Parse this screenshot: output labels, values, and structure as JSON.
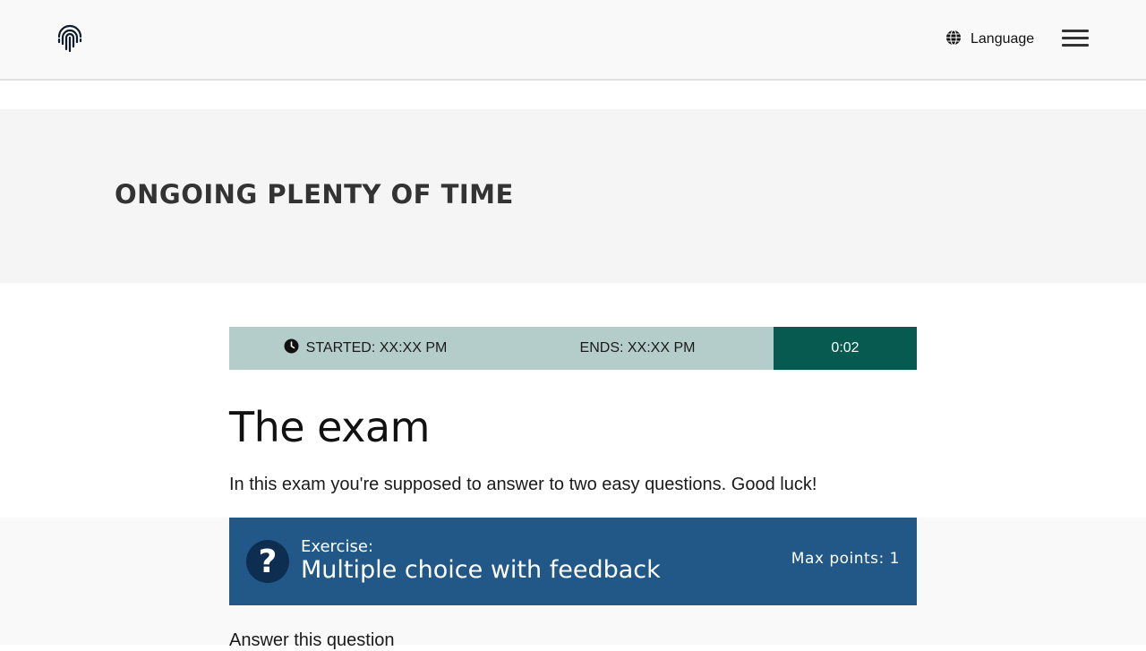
{
  "header": {
    "logo_icon": "fingerprint-icon",
    "language_icon": "globe-icon",
    "language_label": "Language",
    "menu_icon": "hamburger-menu-icon"
  },
  "hero": {
    "title": "ONGOING PLENTY OF TIME"
  },
  "timer": {
    "clock_icon": "clock-icon",
    "started": "STARTED: XX:XX PM",
    "ends": "ENDS: XX:XX PM",
    "countdown": "0:02",
    "colors": {
      "info_bg": "#b4cdcb",
      "countdown_bg": "#065a4f"
    }
  },
  "exam": {
    "title": "The exam",
    "description": "In this exam you're supposed to answer to two easy questions. Good luck!"
  },
  "exercise": {
    "icon": "question-mark-icon",
    "icon_glyph": "?",
    "label": "Exercise:",
    "name": "Multiple choice with feedback",
    "max_points": "Max points: 1",
    "color": "#215887"
  },
  "question": {
    "prompt": "Answer this question"
  }
}
